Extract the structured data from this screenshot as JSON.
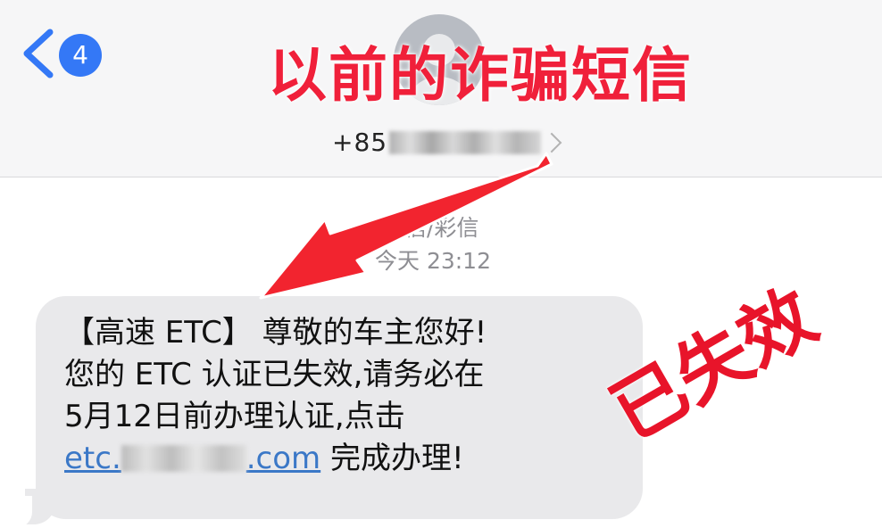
{
  "navbar": {
    "back_badge": "4",
    "contact_number_prefix": "+85"
  },
  "headline": "以前的诈骗短信",
  "thread": {
    "message_type": "短信/彩信",
    "timestamp": "今天 23:12"
  },
  "message": {
    "line1": "【高速 ETC】 尊敬的车主您好!",
    "line2": "您的 ETC 认证已失效,请务必在",
    "line3": "5月12日前办理认证,点击",
    "link_prefix": "etc.",
    "link_suffix": ".com",
    "line4_tail": " 完成办理!"
  },
  "stamp": "已失效",
  "colors": {
    "accent_red": "#f0203a",
    "ios_blue": "#3478f6",
    "bubble_gray": "#e9e9eb"
  }
}
